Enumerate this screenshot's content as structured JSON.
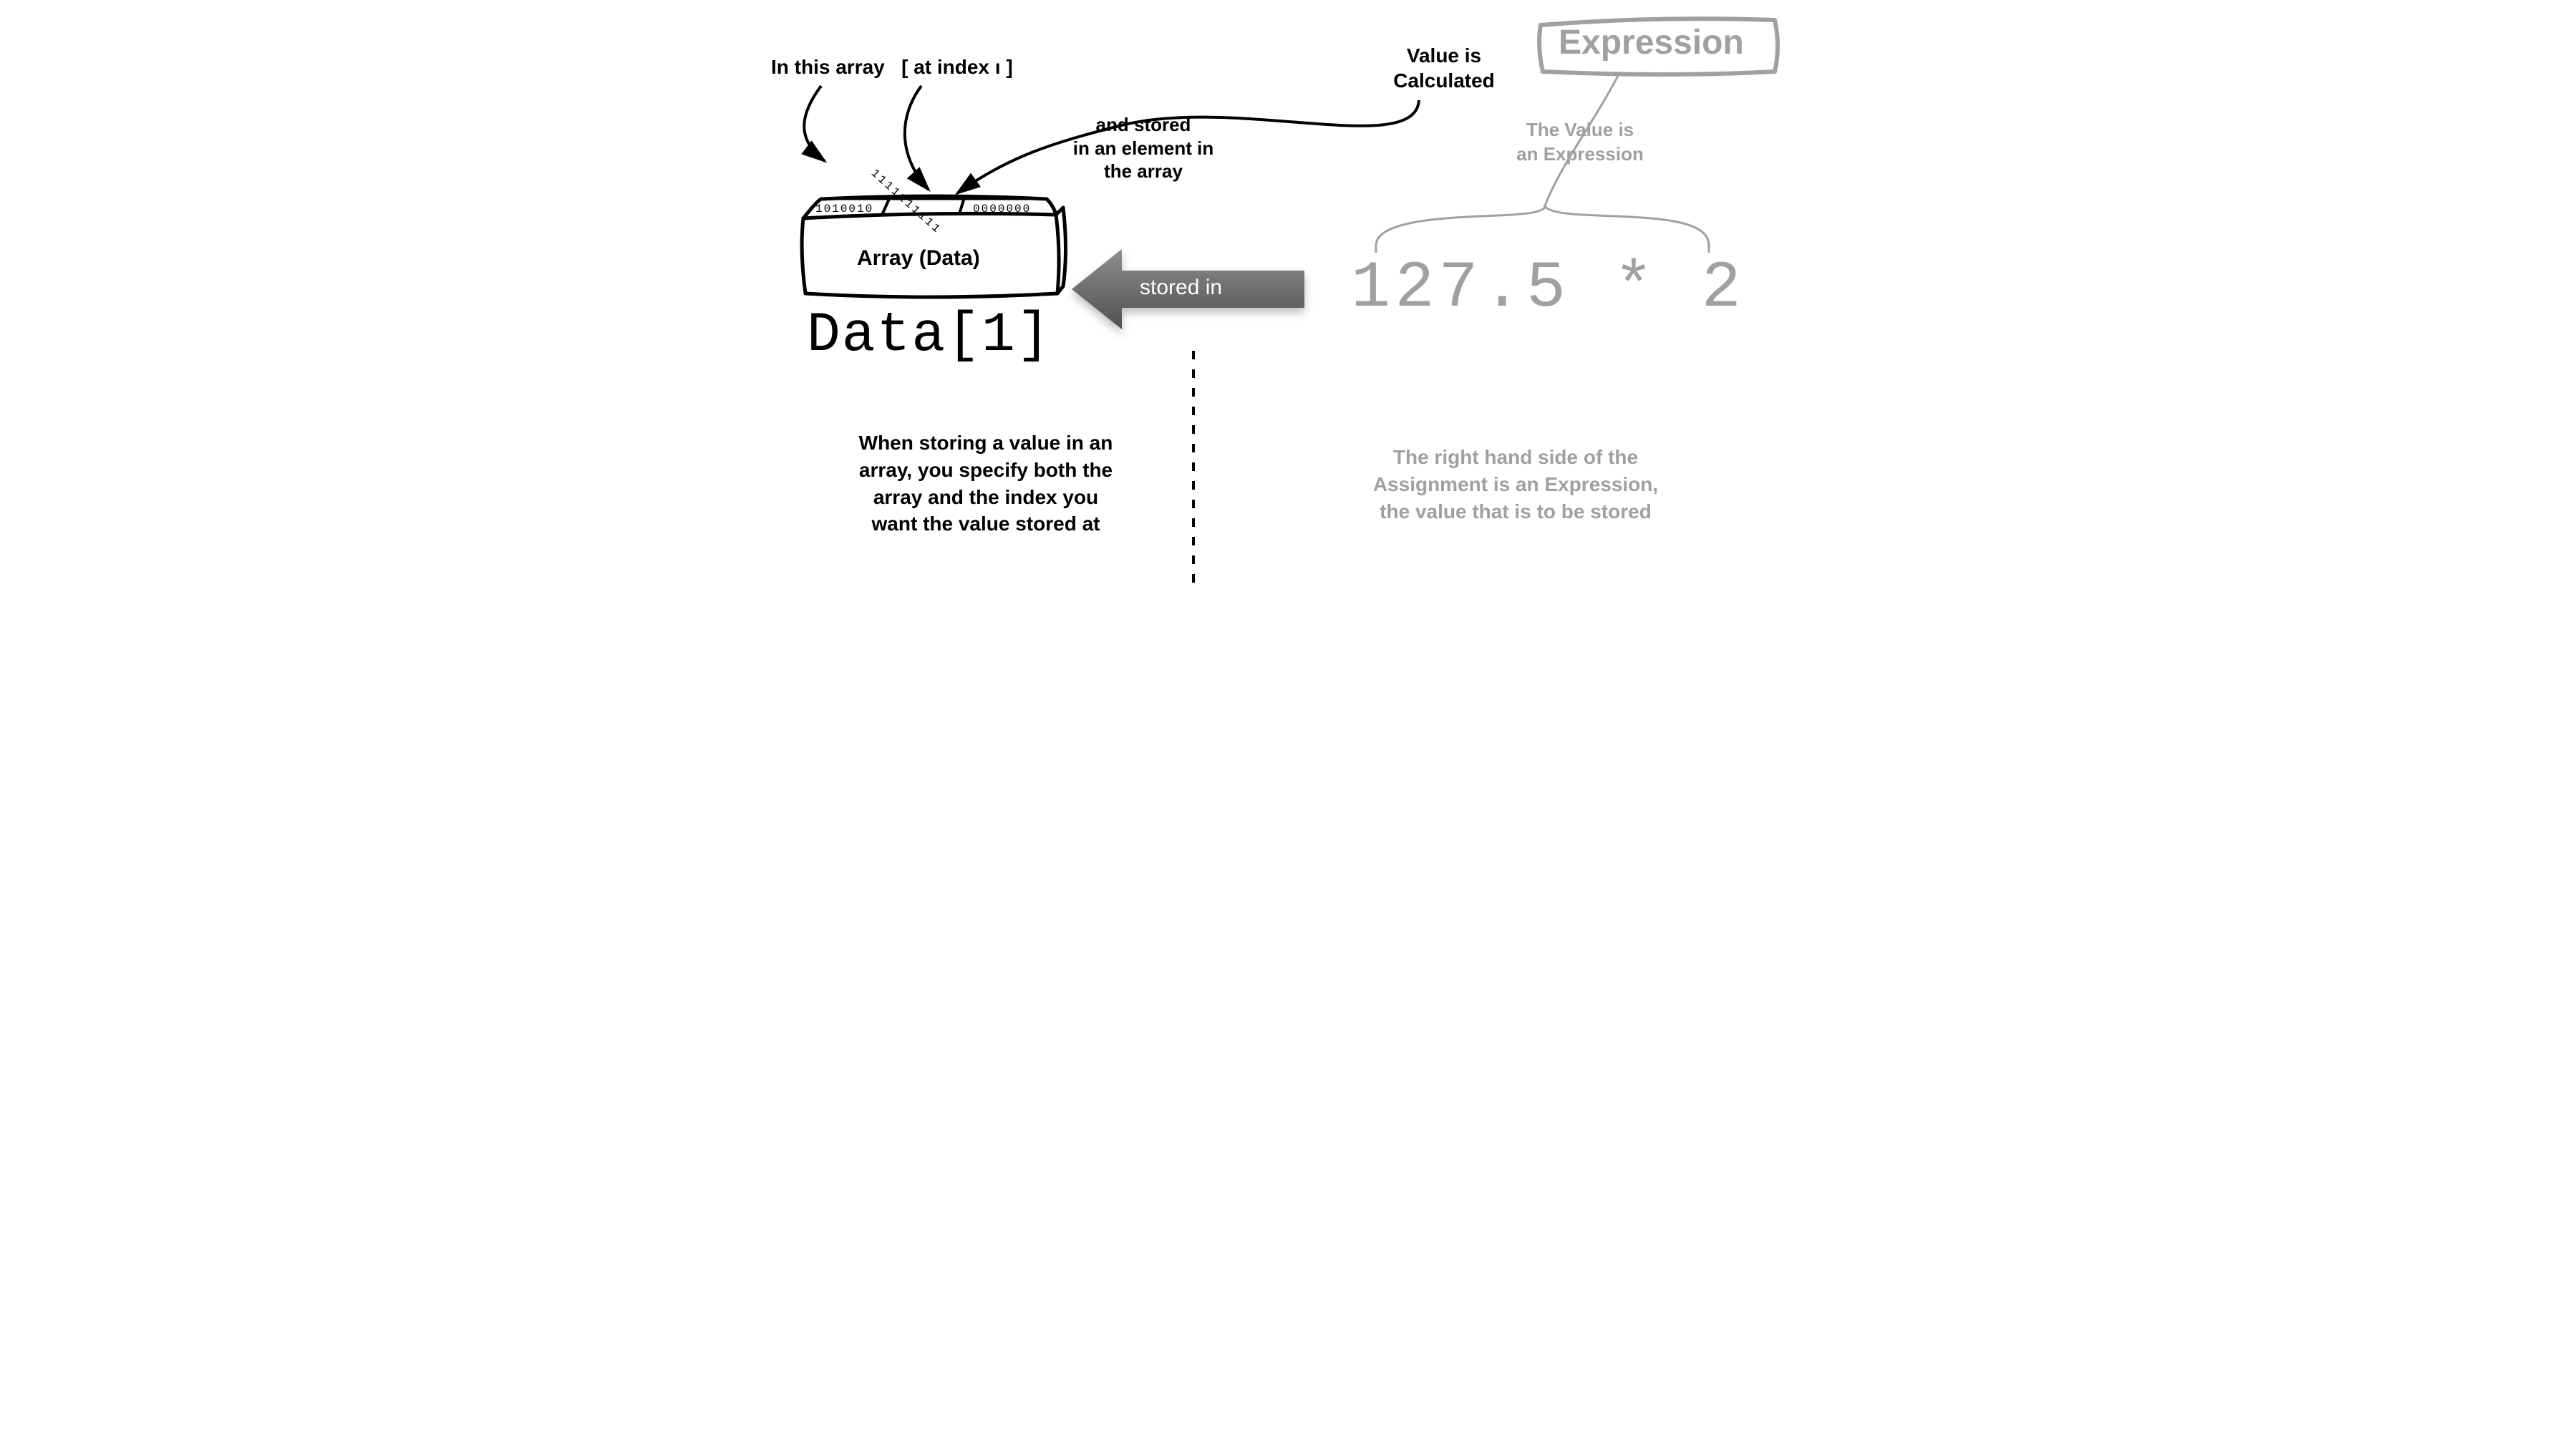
{
  "left": {
    "top_label_1": "In this array",
    "top_label_2": "[ at index ı ]",
    "stored_note_line1": "and stored",
    "stored_note_line2": "in an element in",
    "stored_note_line3": "the array",
    "box_label": "Array (Data)",
    "code": "Data[1]",
    "explain_line1": "When storing a value in an",
    "explain_line2": "array, you specify both the",
    "explain_line3": "array and the index you",
    "explain_line4": "want the value stored at",
    "bits_left": "1010010",
    "bits_mid": "1111111111",
    "bits_right": "0000000"
  },
  "center": {
    "arrow_label": "stored in",
    "value_note_line1": "Value is",
    "value_note_line2": "Calculated"
  },
  "right": {
    "box_label": "Expression",
    "subbox_note_line1": "The Value is",
    "subbox_note_line2": "an Expression",
    "expression": "127.5 * 2",
    "explain_line1": "The right hand side of the",
    "explain_line2": "Assignment is an Expression,",
    "explain_line3": "the value that is to be stored"
  },
  "colors": {
    "gray": "#a0a0a0",
    "dark": "#2d2d2d",
    "arrow_start": "#6d6d6d",
    "arrow_end": "#4a4a4a"
  }
}
